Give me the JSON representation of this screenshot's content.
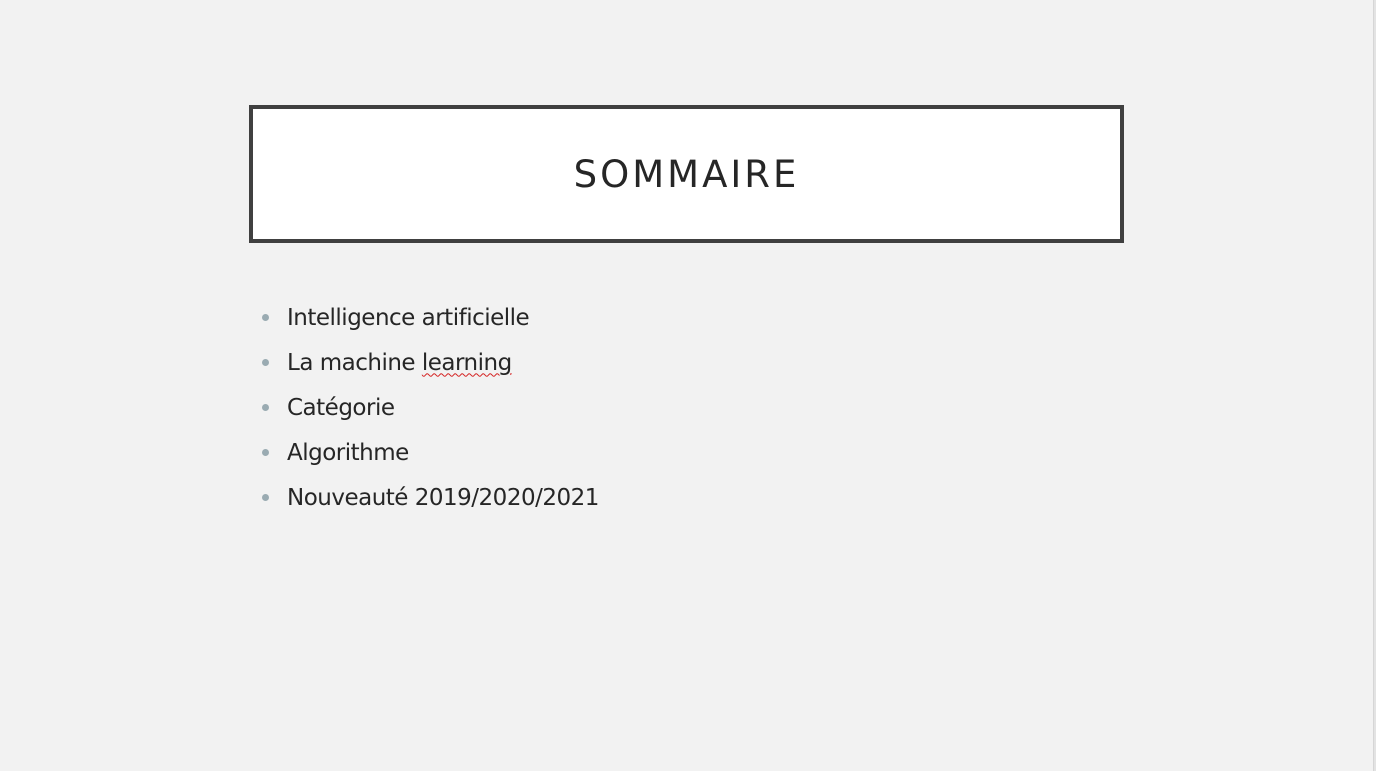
{
  "slide": {
    "title": "SOMMAIRE",
    "bullets": [
      {
        "text": "Intelligence artificielle"
      },
      {
        "text_before": "La machine ",
        "text_flagged": "learning"
      },
      {
        "text": "Catégorie"
      },
      {
        "text": "Algorithme"
      },
      {
        "text": "Nouveauté 2019/2020/2021"
      }
    ]
  },
  "colors": {
    "background": "#f2f2f2",
    "title_border": "#404040",
    "title_fill": "#ffffff",
    "text": "#262626",
    "bullet": "#9aabb2",
    "spellcheck_underline": "#d42020"
  },
  "icons": {
    "bullet": "bullet-dot-icon"
  }
}
